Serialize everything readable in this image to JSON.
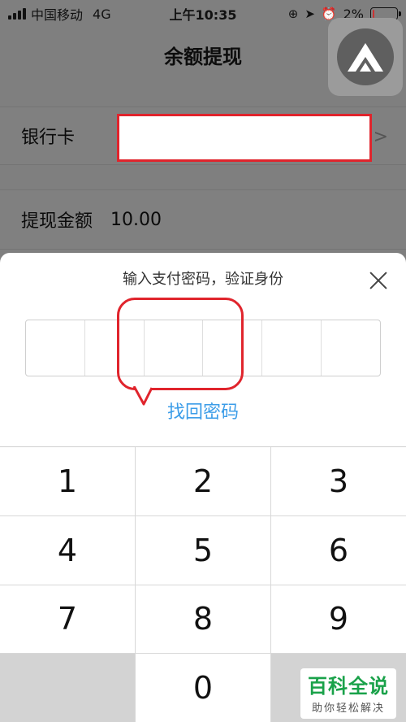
{
  "status_bar": {
    "carrier": "中国移动",
    "network": "4G",
    "time": "上午10:35",
    "battery": "2%",
    "battery_level": 0.02
  },
  "nav": {
    "title": "余额提现"
  },
  "form": {
    "bank_card_label": "银行卡",
    "amount_label": "提现金额",
    "amount_value": "10.00"
  },
  "modal": {
    "title": "输入支付密码，验证身份",
    "forgot_label": "找回密码",
    "pin_length": 6
  },
  "keypad": {
    "keys": [
      "1",
      "2",
      "3",
      "4",
      "5",
      "6",
      "7",
      "8",
      "9",
      "",
      "0",
      ""
    ]
  },
  "watermark": {
    "main": "百科全说",
    "sub": "助你轻松解决"
  },
  "colors": {
    "accent": "#3c9de8",
    "annotation": "#e0242c",
    "watermark": "#1aa24a"
  }
}
